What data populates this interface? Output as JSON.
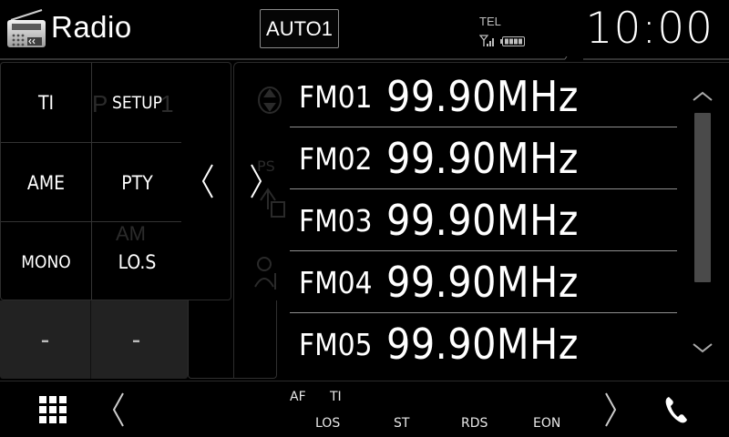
{
  "header": {
    "title": "Radio",
    "seek_mode": "AUTO1",
    "tel_label": "TEL",
    "clock": "10:00",
    "app_icon": "radio-icon",
    "signal_icon": "signal-bars-icon",
    "battery_icon": "battery-icon"
  },
  "controls": {
    "ti": "TI",
    "setup": "SETUP",
    "ame": "AME",
    "pty": "PTY",
    "mono": "MONO",
    "los": "LO.S",
    "slot1": "-",
    "slot2": "-",
    "prev_icon": "chevron-left-icon",
    "next_icon": "chevron-right-icon"
  },
  "presets": [
    {
      "band": "FM01",
      "freq": "99.90MHz"
    },
    {
      "band": "FM02",
      "freq": "99.90MHz"
    },
    {
      "band": "FM03",
      "freq": "99.90MHz"
    },
    {
      "band": "FM04",
      "freq": "99.90MHz"
    },
    {
      "band": "FM05",
      "freq": "99.90MHz"
    }
  ],
  "footer": {
    "menu_icon": "grid-menu-icon",
    "phone_icon": "phone-icon",
    "indicators": {
      "af": "AF",
      "ti": "TI",
      "los": "LOS",
      "st": "ST",
      "rds": "RDS",
      "eon": "EON"
    }
  },
  "colors": {
    "background": "#000000",
    "text": "#ffffff",
    "separator": "#8e8e8e",
    "scrollbar": "#4a4a4a"
  }
}
